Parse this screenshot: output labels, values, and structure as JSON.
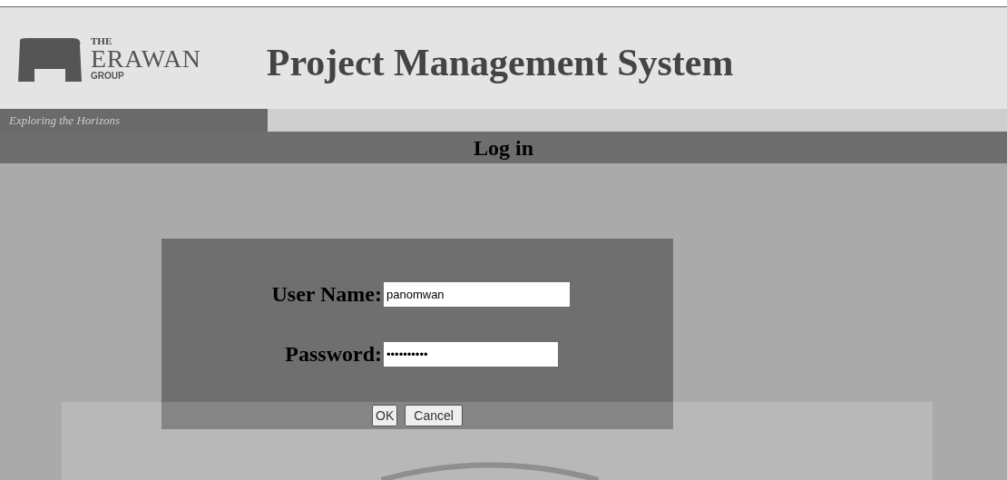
{
  "logo": {
    "the": "THE",
    "name": "ERAWAN",
    "group": "GROUP",
    "tagline": "Exploring the Horizons"
  },
  "title": "Project Management System",
  "bar_title": "Log in",
  "form": {
    "fields": [
      {
        "label": "User Name:",
        "value": "panomwan"
      },
      {
        "label": "Password:",
        "value": "••••••••••"
      }
    ],
    "buttons": [
      "OK",
      "Cancel"
    ]
  }
}
